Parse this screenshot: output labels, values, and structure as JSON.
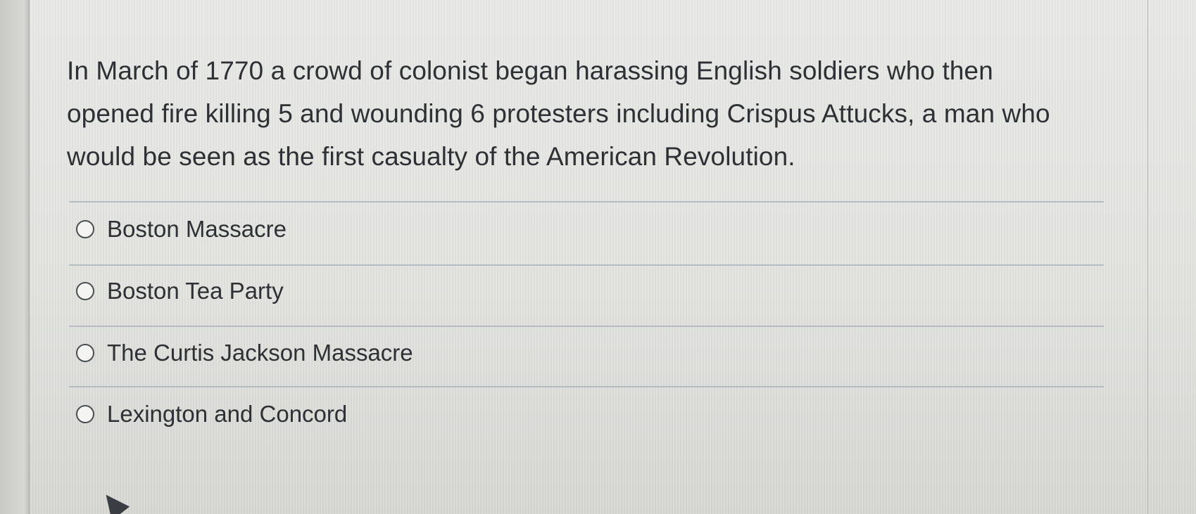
{
  "question": {
    "line1": "In March of 1770 a crowd of colonist began harassing English soldiers who then",
    "line2": "opened fire killing 5 and wounding 6 protesters including Crispus Attucks, a man who",
    "line3": "would be seen as the first casualty of the American Revolution."
  },
  "answers": [
    {
      "label": "Boston Massacre"
    },
    {
      "label": "Boston Tea Party"
    },
    {
      "label": "The Curtis Jackson Massacre"
    },
    {
      "label": "Lexington and Concord"
    }
  ],
  "colors": {
    "background": "#e5e6e2",
    "text": "#2d3035",
    "divider": "#b5bcc2",
    "radio_border": "#4a4f55"
  }
}
